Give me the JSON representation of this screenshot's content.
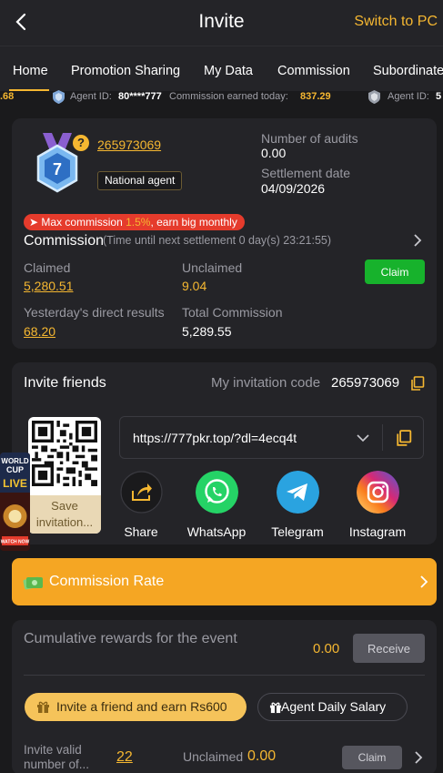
{
  "header": {
    "title": "Invite",
    "switch_label": "Switch to PC"
  },
  "tabs": [
    "Home",
    "Promotion Sharing",
    "My Data",
    "Commission",
    "Subordinate"
  ],
  "ticker": {
    "lead_amount": ".68",
    "agent_label": "Agent ID:",
    "agent_id": "80****777",
    "earned_label": "Commission earned today:",
    "earned_value": "837.29",
    "agent_label_2": "Agent ID:",
    "agent_id_2": "5"
  },
  "agent": {
    "level": "7",
    "help": "?",
    "user_id": "265973069",
    "level_name": "National agent",
    "audits_label": "Number of audits",
    "audits_value": "0.00",
    "settlement_label": "Settlement date",
    "settlement_value": "04/09/2026"
  },
  "commission": {
    "promo_prefix": "Max commission ",
    "promo_rate": "1.5%",
    "promo_suffix": ", earn big monthly",
    "title": "Commission",
    "timer": "(Time until next settlement  0 day(s) 23:21:55)",
    "claimed_label": "Claimed",
    "claimed_value": "5,280.51",
    "unclaimed_label": "Unclaimed",
    "unclaimed_value": "9.04",
    "claim_label": "Claim",
    "yesterday_label": "Yesterday's direct results",
    "yesterday_value": "68.20",
    "total_label": "Total Commission",
    "total_value": "5,289.55"
  },
  "invite": {
    "title": "Invite friends",
    "code_label": "My invitation code",
    "code": "265973069",
    "save_label": "Save invitation...",
    "link": "https://777pkr.top/?dl=4ecq4t",
    "share": [
      {
        "label": "Share",
        "icon": "share-icon",
        "color": "#1a1a1c"
      },
      {
        "label": "WhatsApp",
        "icon": "whatsapp-icon",
        "color": "#25d366"
      },
      {
        "label": "Telegram",
        "icon": "telegram-icon",
        "color": "#2aa3e0"
      },
      {
        "label": "Instagram",
        "icon": "instagram-icon",
        "color": "#dd2a7b"
      }
    ]
  },
  "promo_badge": {
    "line1": "WORLD",
    "line2": "CUP",
    "line3": "LIVE",
    "line4": "WATCH NOW"
  },
  "rate": {
    "label": "Commission Rate"
  },
  "rewards": {
    "title": "Cumulative rewards for the event",
    "value": "0.00",
    "receive_label": "Receive",
    "invite_pill": "Invite a friend and earn Rs600",
    "salary_pill": "Agent Daily Salary",
    "valid_label": "Invite valid number of...",
    "valid_value": "22",
    "unclaimed_label": "Unclaimed",
    "unclaimed_value": "0.00",
    "claim_label": "Claim"
  },
  "colors": {
    "accent": "#f5b731",
    "green": "#17b22c",
    "orange": "#f5a623",
    "bg": "#1a1a1c",
    "card": "#242428"
  }
}
